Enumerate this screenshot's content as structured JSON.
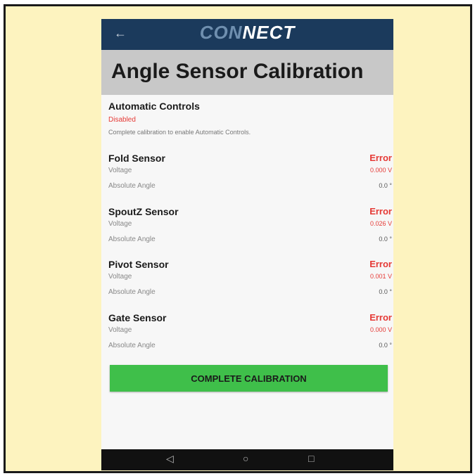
{
  "app": {
    "logo_prefix": "CON",
    "logo_suffix": "NECT",
    "back_icon": "←"
  },
  "page": {
    "title": "Angle Sensor Calibration"
  },
  "automatic_controls": {
    "title": "Automatic Controls",
    "status": "Disabled",
    "description": "Complete calibration to enable Automatic Controls."
  },
  "sensors": [
    {
      "name": "Fold Sensor",
      "status": "Error",
      "voltage_label": "Voltage",
      "voltage": "0.000 V",
      "angle_label": "Absolute Angle",
      "angle": "0.0 °"
    },
    {
      "name": "SpoutZ Sensor",
      "status": "Error",
      "voltage_label": "Voltage",
      "voltage": "0.026 V",
      "angle_label": "Absolute Angle",
      "angle": "0.0 °"
    },
    {
      "name": "Pivot Sensor",
      "status": "Error",
      "voltage_label": "Voltage",
      "voltage": "0.001 V",
      "angle_label": "Absolute Angle",
      "angle": "0.0 °"
    },
    {
      "name": "Gate Sensor",
      "status": "Error",
      "voltage_label": "Voltage",
      "voltage": "0.000 V",
      "angle_label": "Absolute Angle",
      "angle": "0.0 °"
    }
  ],
  "actions": {
    "complete_calibration": "COMPLETE CALIBRATION"
  },
  "navbar": {
    "back": "◁",
    "home": "○",
    "recents": "□"
  },
  "colors": {
    "topbar": "#1b3a5c",
    "error": "#e53935",
    "button": "#3fbf4a",
    "frame_bg": "#fdf3bf"
  }
}
